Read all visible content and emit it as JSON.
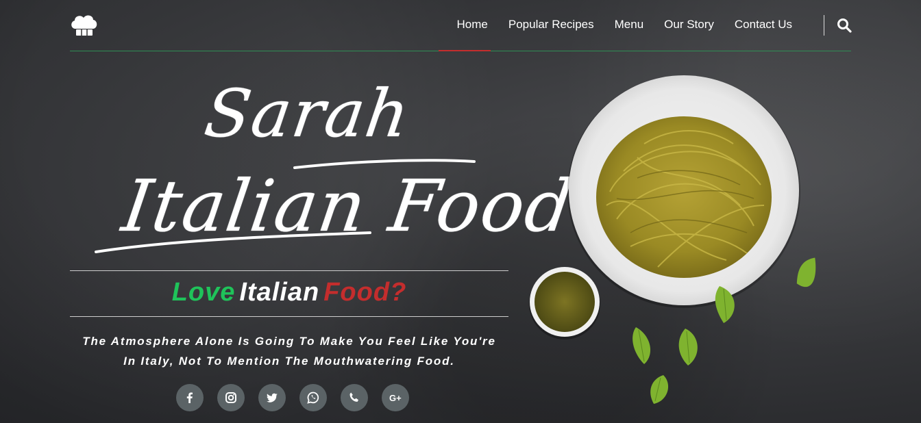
{
  "nav": {
    "logo_icon": "chef-hat-icon",
    "links": [
      {
        "label": "Home",
        "active": true
      },
      {
        "label": "Popular Recipes"
      },
      {
        "label": "Menu"
      },
      {
        "label": "Our Story"
      },
      {
        "label": "Contact Us"
      }
    ],
    "search_icon": "search-icon"
  },
  "hero": {
    "title_line1": "Sarah",
    "title_line2": "Italian Food",
    "tagline": {
      "part1": "Love",
      "part2": "Italian",
      "part3": "Food?",
      "colors": {
        "part1": "#1fc35a",
        "part2": "#ffffff",
        "part3": "#c42d2d"
      }
    },
    "description_line1": "The Atmosphere Alone Is Going To Make You Feel Like You're",
    "description_line2": "In Italy, Not To Mention The Mouthwatering Food.",
    "social_icons": [
      "facebook-icon",
      "instagram-icon",
      "twitter-icon",
      "whatsapp-icon",
      "phone-icon",
      "google-plus-icon"
    ]
  },
  "colors": {
    "accent_green": "#2f8f55",
    "accent_red": "#c42d2d",
    "social_bg": "#5b6366"
  }
}
